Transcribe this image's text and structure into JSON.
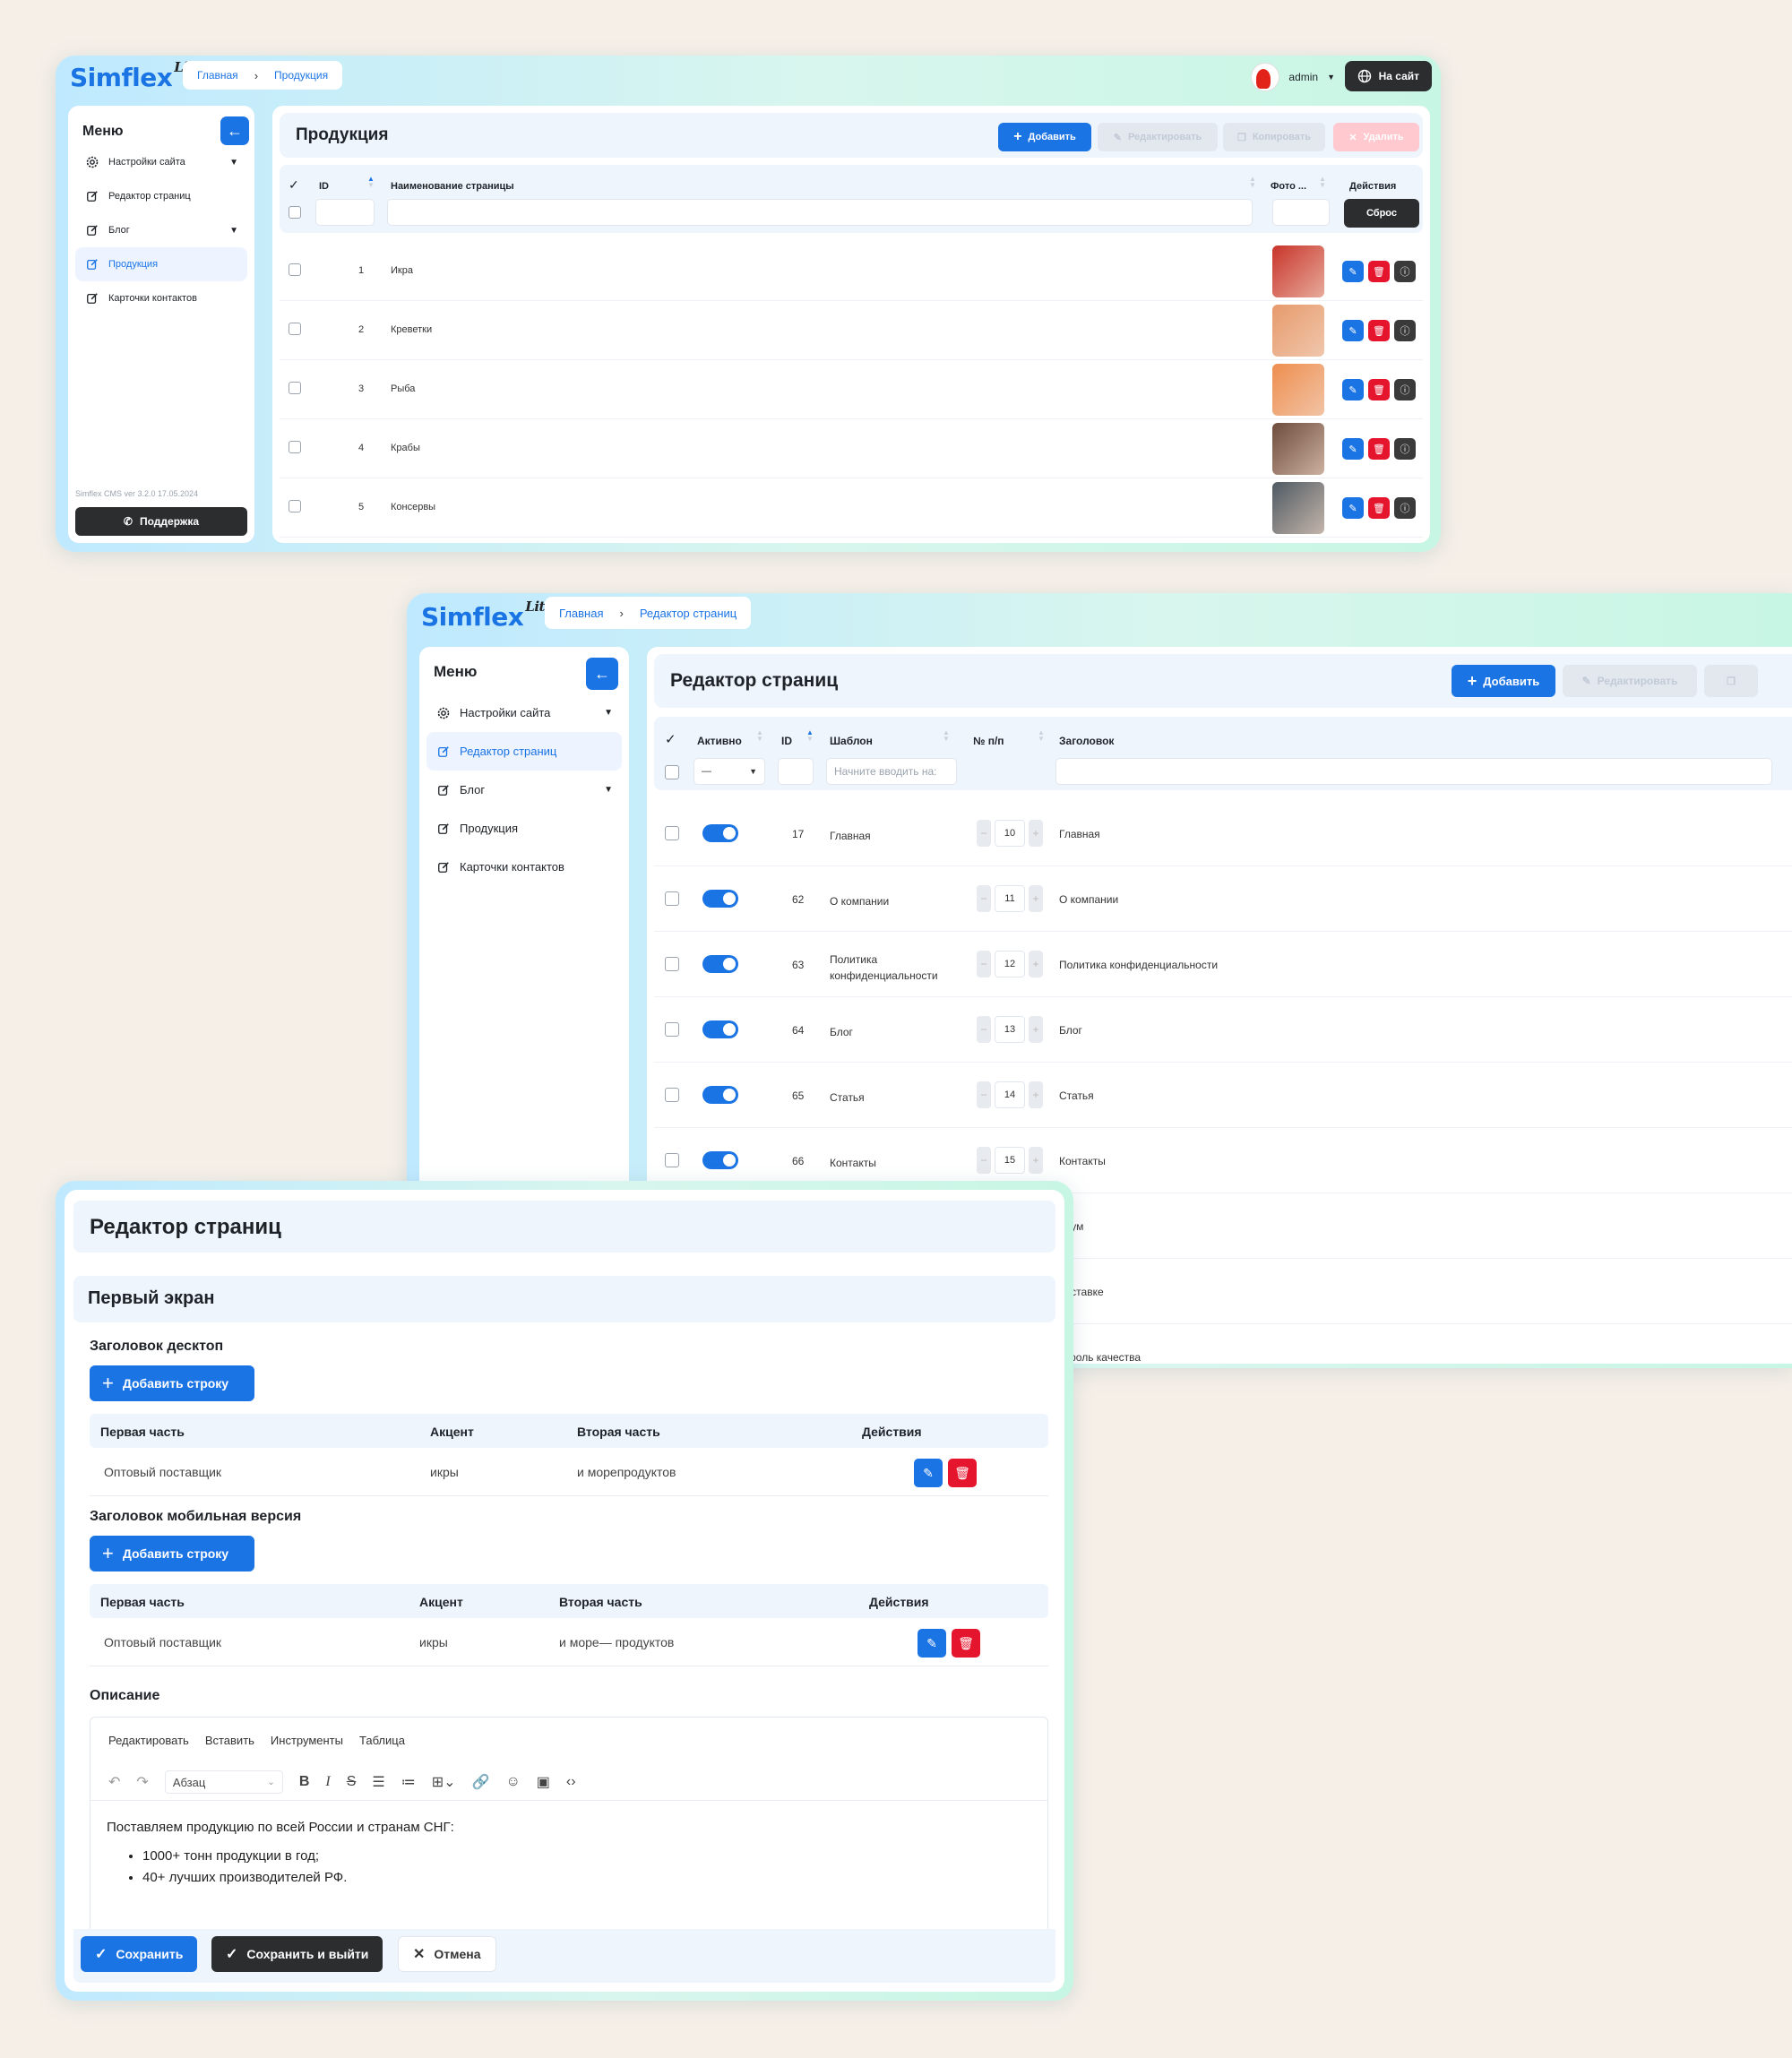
{
  "w1": {
    "logo": "Simflex",
    "logo_sup": "Lite",
    "crumbs": [
      "Главная",
      "Продукция"
    ],
    "user": "admin",
    "site_btn": "На сайт",
    "menu_title": "Меню",
    "nav": [
      {
        "label": "Настройки сайта",
        "icon": "gear-icon"
      },
      {
        "label": "Редактор страниц",
        "icon": "edit-icon"
      },
      {
        "label": "Блог",
        "icon": "edit-icon"
      },
      {
        "label": "Продукция",
        "icon": "edit-icon"
      },
      {
        "label": "Карточки контактов",
        "icon": "edit-icon"
      }
    ],
    "version": "Simflex CMS ver 3.2.0 17.05.2024",
    "support": "Поддержка",
    "page_title": "Продукция",
    "buttons": {
      "add": "Добавить",
      "edit": "Редактировать",
      "copy": "Копировать",
      "delete": "Удалить",
      "reset": "Сброс"
    },
    "columns": {
      "id": "ID",
      "name": "Наименование страницы",
      "photo": "Фото ...",
      "actions": "Действия"
    },
    "rows": [
      {
        "id": "1",
        "name": "Икра",
        "color": "#c8342a"
      },
      {
        "id": "2",
        "name": "Креветки",
        "color": "#e79a6b"
      },
      {
        "id": "3",
        "name": "Рыба",
        "color": "#ee8e4f"
      },
      {
        "id": "4",
        "name": "Крабы",
        "color": "#6d4c3d"
      },
      {
        "id": "5",
        "name": "Консервы",
        "color": "#4f5a63"
      }
    ]
  },
  "w2": {
    "logo": "Simflex",
    "logo_sup": "Lite",
    "crumbs": [
      "Главная",
      "Редактор страниц"
    ],
    "menu_title": "Меню",
    "nav": [
      {
        "label": "Настройки сайта",
        "icon": "gear-icon"
      },
      {
        "label": "Редактор страниц",
        "icon": "edit-icon"
      },
      {
        "label": "Блог",
        "icon": "edit-icon"
      },
      {
        "label": "Продукция",
        "icon": "edit-icon"
      },
      {
        "label": "Карточки контактов",
        "icon": "edit-icon"
      }
    ],
    "page_title": "Редактор страниц",
    "buttons": {
      "add": "Добавить",
      "edit": "Редактировать"
    },
    "columns": {
      "active": "Активно",
      "id": "ID",
      "template": "Шаблон",
      "order": "№ п/п",
      "title": "Заголовок"
    },
    "filters": {
      "active": "—",
      "template_placeholder": "Начните вводить на:"
    },
    "rows": [
      {
        "id": "17",
        "template": "Главная",
        "order": "10",
        "title": "Главная"
      },
      {
        "id": "62",
        "template": "О компании",
        "order": "11",
        "title": "О компании"
      },
      {
        "id": "63",
        "template": "Политика конфиденциальности",
        "order": "12",
        "title": "Политика конфиденциальности"
      },
      {
        "id": "64",
        "template": "Блог",
        "order": "13",
        "title": "Блог"
      },
      {
        "id": "65",
        "template": "Статья",
        "order": "14",
        "title": "Статья"
      },
      {
        "id": "66",
        "template": "Контакты",
        "order": "15",
        "title": "Контакты"
      }
    ],
    "partial": [
      "орум",
      "поставке",
      "нтроль качества"
    ]
  },
  "w3": {
    "page_title": "Редактор страниц",
    "section": "Первый экран",
    "desktop_label": "Заголовок десктоп",
    "mobile_label": "Заголовок мобильная версия",
    "add_row": "Добавить строку",
    "columns": {
      "first": "Первая часть",
      "accent": "Акцент",
      "second": "Вторая часть",
      "actions": "Действия"
    },
    "desktop_row": {
      "first": "Оптовый поставщик",
      "accent": "икры",
      "second": "и морепродуктов"
    },
    "mobile_row": {
      "first": "Оптовый поставщик",
      "accent": "икры",
      "second": "и море— продуктов"
    },
    "description_label": "Описание",
    "editor_menu": [
      "Редактировать",
      "Вставить",
      "Инструменты",
      "Таблица"
    ],
    "format": "Абзац",
    "content_p": "Поставляем продукцию по всей России и странам СНГ:",
    "content_list": [
      "1000+ тонн продукции в год;",
      "40+ лучших производителей РФ."
    ],
    "footer": {
      "save": "Сохранить",
      "save_exit": "Сохранить и выйти",
      "cancel": "Отмена"
    }
  },
  "colors": {
    "accent": "#1b74e4",
    "danger": "#e6152e",
    "dark": "#2b2d2f"
  }
}
